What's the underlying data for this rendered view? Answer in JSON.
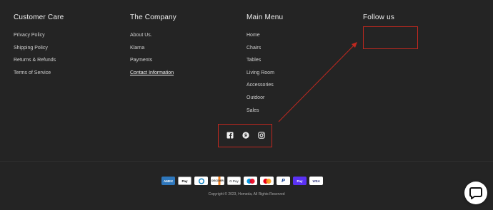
{
  "columns": [
    {
      "title": "Customer Care",
      "links": [
        "Privacy Policy",
        "Shipping Policy",
        "Returns & Refunds",
        "Terms of Service"
      ]
    },
    {
      "title": "The Company",
      "links": [
        "About Us.",
        "Klarna",
        "Payments",
        "Contact Information"
      ]
    },
    {
      "title": "Main Menu",
      "links": [
        "Home",
        "Chairs",
        "Tables",
        "Living Room",
        "Accessories",
        "Outdoor",
        "Sales"
      ]
    },
    {
      "title": "Follow us",
      "links": []
    }
  ],
  "social_icons": [
    "facebook-icon",
    "pinterest-icon",
    "instagram-icon"
  ],
  "payment_methods": [
    {
      "label": "AMEX",
      "bg": "#2e77bc",
      "fg": "#ffffff"
    },
    {
      "label": "Pay",
      "bg": "#ffffff",
      "fg": "#000000"
    },
    {
      "label": "D",
      "bg": "#ffffff",
      "fg": "#0079be"
    },
    {
      "label": "DISCOVER",
      "bg": "#ffffff",
      "fg": "#222222"
    },
    {
      "label": "G Pay",
      "bg": "#ffffff",
      "fg": "#5f6368"
    },
    {
      "label": "",
      "bg": "#ffffff",
      "fg": "#222222"
    },
    {
      "label": "",
      "bg": "#ffffff",
      "fg": "#222222"
    },
    {
      "label": "P",
      "bg": "#ffffff",
      "fg": "#003087"
    },
    {
      "label": "Pay",
      "bg": "#5a31f4",
      "fg": "#ffffff"
    },
    {
      "label": "VISA",
      "bg": "#ffffff",
      "fg": "#1a1f71"
    }
  ],
  "copyright": "Copyright © 2023, Homeda, All Rights Reserved",
  "colors": {
    "background": "#242424",
    "annotation": "#c0281f"
  }
}
